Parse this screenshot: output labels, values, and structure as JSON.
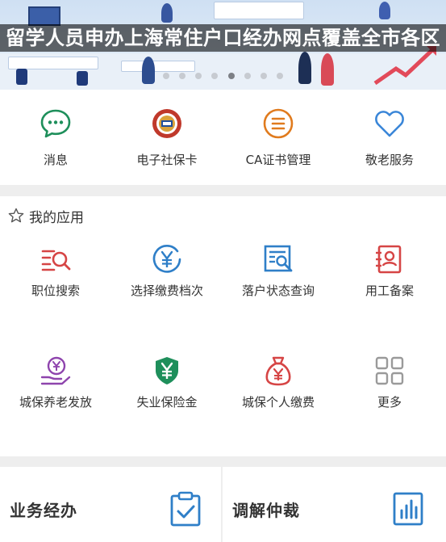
{
  "banner": {
    "caption": "留学人员申办上海常住户口经办网点覆盖全市各区",
    "dots_count": 8,
    "active_dot_index": 4
  },
  "quick_actions": [
    {
      "label": "消息",
      "icon": "chat-bubble-icon",
      "color": "#1e8f5b"
    },
    {
      "label": "电子社保卡",
      "icon": "social-security-card-icon",
      "color": "#c0392b"
    },
    {
      "label": "CA证书管理",
      "icon": "list-circle-icon",
      "color": "#e07b1e"
    },
    {
      "label": "敬老服务",
      "icon": "heart-icon",
      "color": "#3a86d8"
    }
  ],
  "my_apps": {
    "title": "我的应用",
    "items": [
      {
        "label": "职位搜索",
        "icon": "job-search-icon",
        "color": "#d64545"
      },
      {
        "label": "选择缴费档次",
        "icon": "yen-circle-icon",
        "color": "#2f7fc8"
      },
      {
        "label": "落户状态查询",
        "icon": "document-search-icon",
        "color": "#2f7fc8"
      },
      {
        "label": "用工备案",
        "icon": "contract-icon",
        "color": "#d64545"
      },
      {
        "label": "城保养老发放",
        "icon": "yen-hand-icon",
        "color": "#8e44ad"
      },
      {
        "label": "失业保险金",
        "icon": "yen-shield-icon",
        "color": "#1e8f5b"
      },
      {
        "label": "城保个人缴费",
        "icon": "money-bag-icon",
        "color": "#d64545"
      },
      {
        "label": "更多",
        "icon": "grid-more-icon",
        "color": "#9a9a9a"
      }
    ]
  },
  "bottom_cards": [
    {
      "label": "业务经办",
      "icon": "clipboard-check-icon",
      "color": "#2f7fc8"
    },
    {
      "label": "调解仲裁",
      "icon": "bar-chart-icon",
      "color": "#2f7fc8"
    }
  ]
}
